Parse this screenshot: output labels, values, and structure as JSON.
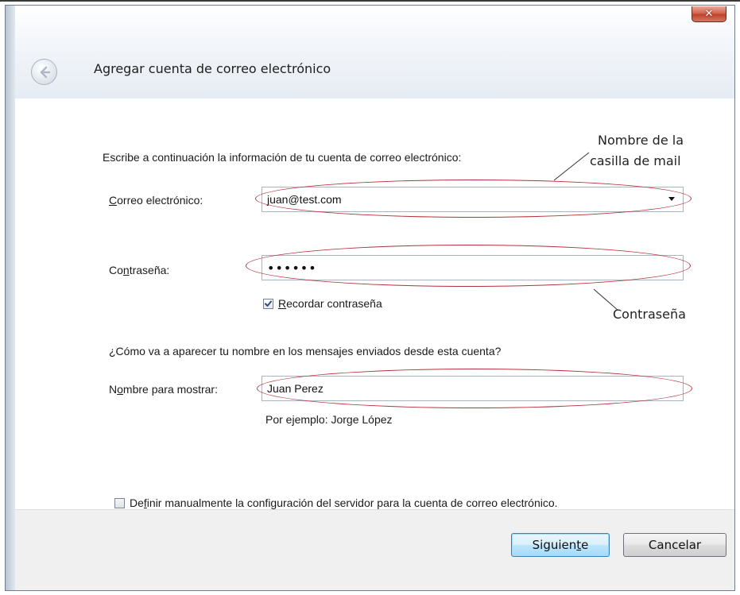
{
  "window": {
    "title": "Agregar cuenta de correo electrónico",
    "close_glyph": "✕",
    "back_icon": "back-arrow-icon"
  },
  "form": {
    "intro": "Escribe a continuación la información de tu cuenta de correo electrónico:",
    "email_label_prefix": "C",
    "email_label_rest": "orreo electrónico:",
    "email_value": "juan@test.com",
    "password_label_prefix": "Co",
    "password_label_accel": "n",
    "password_label_rest": "traseña:",
    "password_value": "••••••",
    "remember_accel": "R",
    "remember_rest": "ecordar contraseña",
    "remember_checked": true,
    "display_question": "¿Cómo va a aparecer tu nombre en los mensajes enviados desde esta cuenta?",
    "display_label_prefix": "N",
    "display_label_accel": "o",
    "display_label_rest": "mbre para mostrar:",
    "display_value": "Juan Perez",
    "display_example": "Por ejemplo: Jorge López",
    "manual_prefix": "De",
    "manual_accel": "f",
    "manual_rest": "inir manualmente la configuración del servidor para la cuenta de correo electrónico.",
    "manual_checked": false
  },
  "annotations": {
    "mailbox_line1": "Nombre de la",
    "mailbox_line2": "casilla de mail",
    "password": "Contraseña",
    "oval_color": "#b4323a"
  },
  "buttons": {
    "next_prefix": "Siguien",
    "next_accel": "t",
    "next_rest": "e",
    "cancel": "Cancelar"
  },
  "colors": {
    "close_button": "#c9503a",
    "next_button_border": "#3c7fb1",
    "checkbox_check": "#2a4f8a"
  }
}
